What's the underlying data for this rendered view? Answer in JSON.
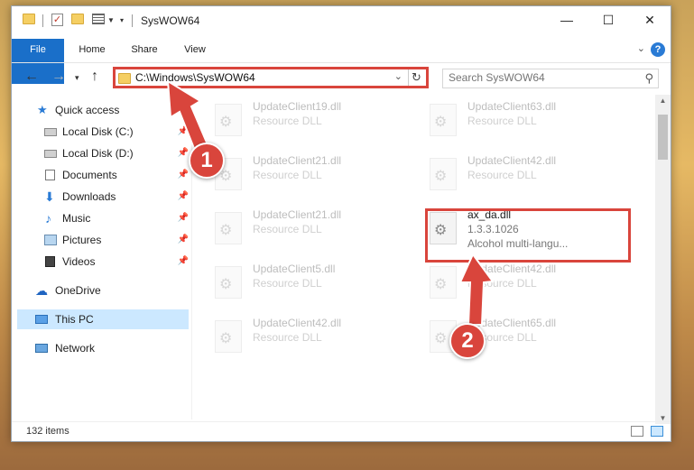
{
  "window": {
    "title": "SysWOW64"
  },
  "ribbon": {
    "tabs": [
      "File",
      "Home",
      "Share",
      "View"
    ]
  },
  "address": {
    "path": "C:\\Windows\\SysWOW64"
  },
  "search": {
    "placeholder": "Search SysWOW64"
  },
  "navpane": {
    "quick_access": "Quick access",
    "items": [
      {
        "label": "Local Disk (C:)",
        "icon": "drive-icon",
        "pinned": true
      },
      {
        "label": "Local Disk (D:)",
        "icon": "drive-icon",
        "pinned": true
      },
      {
        "label": "Documents",
        "icon": "documents-icon",
        "pinned": true
      },
      {
        "label": "Downloads",
        "icon": "downloads-icon",
        "pinned": true
      },
      {
        "label": "Music",
        "icon": "music-icon",
        "pinned": true
      },
      {
        "label": "Pictures",
        "icon": "pictures-icon",
        "pinned": true
      },
      {
        "label": "Videos",
        "icon": "videos-icon",
        "pinned": true
      }
    ],
    "onedrive": "OneDrive",
    "thispc": "This PC",
    "network": "Network"
  },
  "files": [
    {
      "name": "UpdateClient19.dll",
      "type": "Resource DLL"
    },
    {
      "name": "UpdateClient63.dll",
      "type": "Resource DLL"
    },
    {
      "name": "UpdateClient21.dll",
      "type": "Resource DLL"
    },
    {
      "name": "UpdateClient42.dll",
      "type": "Resource DLL"
    },
    {
      "name": "UpdateClient21.dll",
      "type": "Resource DLL"
    },
    {
      "name": "ax_da.dll",
      "type": "1.3.3.1026",
      "desc": "Alcohol multi-langu..."
    },
    {
      "name": "UpdateClient5.dll",
      "type": "Resource DLL"
    },
    {
      "name": "UpdateClient42.dll",
      "type": "Resource DLL"
    },
    {
      "name": "UpdateClient42.dll",
      "type": "Resource DLL"
    },
    {
      "name": "UpdateClient65.dll",
      "type": "Resource DLL"
    }
  ],
  "status": {
    "items": "132 items"
  },
  "callouts": [
    "1",
    "2"
  ],
  "colors": {
    "accent": "#1a6fc9",
    "annotation": "#d9453c",
    "selected": "#cce8ff"
  }
}
